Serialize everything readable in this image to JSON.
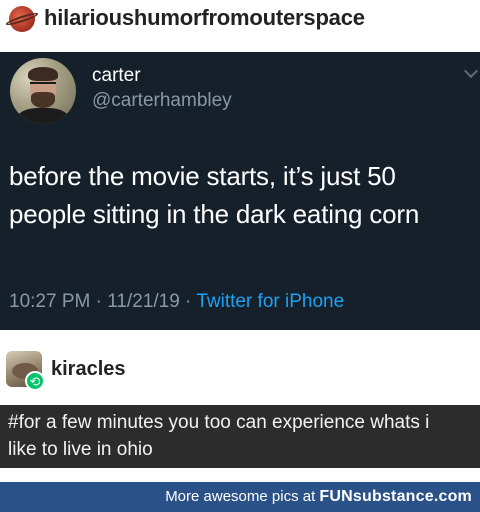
{
  "top_post": {
    "username": "hilarioushumorfromouterspace",
    "avatar_icon": "planet-icon"
  },
  "tweet": {
    "name": "carter",
    "handle": "@carterhambley",
    "text_line1": "before the movie starts, it’s just 50",
    "text_line2": "people sitting in the dark eating corn",
    "time": "10:27 PM · 11/21/19 · ",
    "source": "Twitter for iPhone",
    "colors": {
      "background": "#15202b",
      "link": "#1da1f2",
      "muted": "#8899a6"
    }
  },
  "reblog": {
    "username": "kiracles",
    "badge_icon": "reblog-icon",
    "tag_line1": "#for a few minutes you too can experience whats i",
    "tag_line2": "like to live in ohio"
  },
  "footer": {
    "text": "More awesome pics at ",
    "brand": "FUNsubstance.com",
    "color": "#2b5288"
  }
}
